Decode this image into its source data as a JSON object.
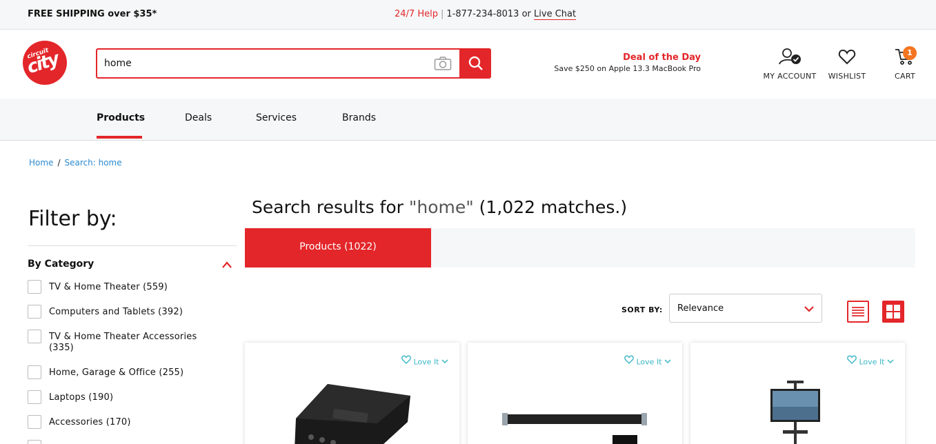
{
  "topbar": {
    "shipping": "FREE SHIPPING over $35*",
    "help_label": "24/7 Help",
    "separator": "|",
    "phone": "1-877-234-8013",
    "or": "or",
    "chat": "Live Chat"
  },
  "header": {
    "logo_small": "circuit",
    "logo_big": "city",
    "search_value": "home",
    "deal_title": "Deal of the Day",
    "deal_sub": "Save $250 on Apple 13.3 MacBook Pro",
    "account": "MY ACCOUNT",
    "wishlist": "WISHLIST",
    "cart": "CART",
    "cart_count": "1"
  },
  "nav": {
    "items": [
      "Products",
      "Deals",
      "Services",
      "Brands"
    ]
  },
  "breadcrumb": {
    "home": "Home",
    "slash": "/",
    "current": "Search: home"
  },
  "filter": {
    "title": "Filter by:",
    "category_heading": "By Category",
    "categories": [
      "TV & Home Theater (559)",
      "Computers and Tablets (392)",
      "TV & Home Theater Accessories (335)",
      "Home, Garage & Office (255)",
      "Laptops (190)",
      "Accessories (170)"
    ]
  },
  "results": {
    "prefix": "Search results for ",
    "query": "\"home\"",
    "suffix": " (1,022 matches.)",
    "tab": "Products (1022)",
    "sort_label": "SORT BY:",
    "sort_value": "Relevance",
    "love_label": "Love It"
  },
  "colors": {
    "brand_red": "#e3262a",
    "link_blue": "#2d8ad0",
    "love_teal": "#3ab6c6",
    "badge_orange": "#f47521"
  }
}
